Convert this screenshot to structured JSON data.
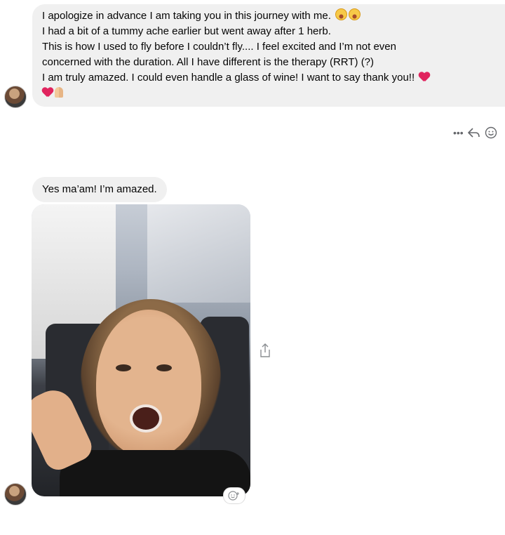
{
  "message_1": {
    "lines": [
      "I apologize in advance I am taking you in this journey with me.",
      "I had a bit of a tummy ache earlier but went away after 1 herb.",
      "This is how I used to fly before I couldn’t fly.... I feel excited and I’m not even",
      "concerned with the duration. All I have different is the therapy (RRT) (?)",
      "I am truly amazed. I could even handle a glass of wine! I want to say thank you!!"
    ],
    "emojis": [
      "grinning-squinting-face",
      "grinning-squinting-face",
      "red-heart",
      "sparkling-heart",
      "folded-hands"
    ]
  },
  "message_actions": {
    "more_label": "•••",
    "icons": [
      "more-icon",
      "reply-icon",
      "react-icon"
    ]
  },
  "message_2": {
    "text": "Yes ma’am! I’m amazed."
  },
  "photo": {
    "description_icon": "selfie-photo"
  },
  "colors": {
    "bubble_bg": "#f0f0f0",
    "text": "#050505",
    "icon_gray": "#65676b",
    "heart": "#e0245e"
  }
}
